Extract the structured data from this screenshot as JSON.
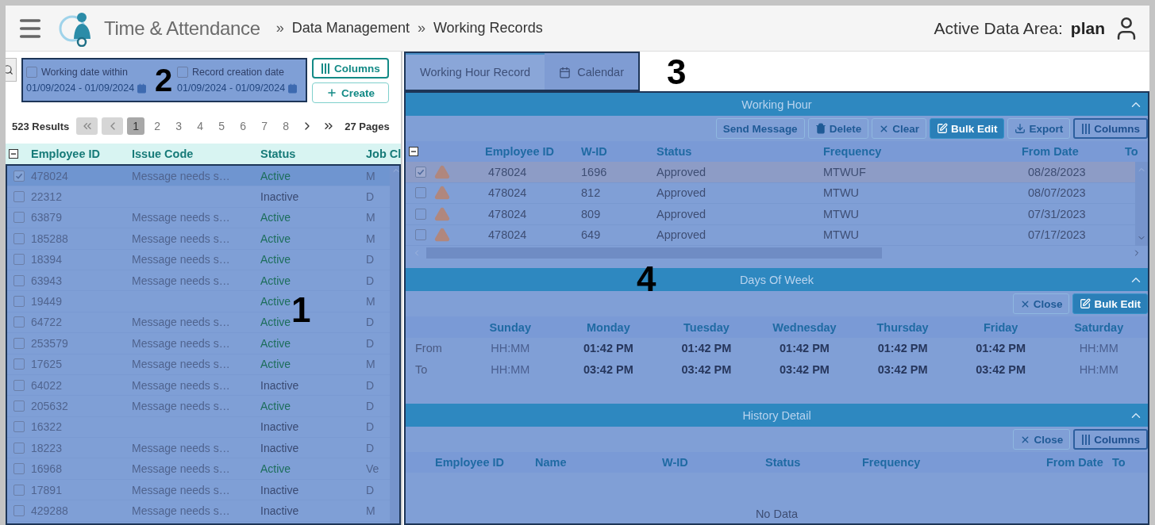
{
  "header": {
    "app_title": "Time & Attendance",
    "breadcrumbs": [
      {
        "separator": "»",
        "label": "Data Management"
      },
      {
        "separator": "»",
        "label": "Working Records"
      }
    ],
    "data_area_label": "Active Data Area:",
    "data_area_value": "plan"
  },
  "filters": [
    {
      "label": "Working date within",
      "checked": false,
      "range": "01/09/2024 - 01/09/2024"
    },
    {
      "label": "Record creation date",
      "checked": false,
      "range": "01/09/2024 - 01/09/2024"
    }
  ],
  "left_buttons": [
    {
      "label": "Columns",
      "kind": "columns"
    },
    {
      "label": "Create",
      "kind": "create"
    }
  ],
  "pagination": {
    "results": "523 Results",
    "pages": [
      {
        "label": "1",
        "selected": true
      },
      {
        "label": "2",
        "selected": false
      },
      {
        "label": "3",
        "selected": false
      },
      {
        "label": "4",
        "selected": false
      },
      {
        "label": "5",
        "selected": false
      },
      {
        "label": "6",
        "selected": false
      },
      {
        "label": "7",
        "selected": false
      },
      {
        "label": "8",
        "selected": false
      }
    ],
    "total": "27 Pages"
  },
  "employee_table": {
    "select_all_partial": true,
    "columns": [
      "Employee ID",
      "Issue Code",
      "Status",
      "Job Cl"
    ],
    "rows": [
      {
        "selected": true,
        "checked": true,
        "employee_id": "478024",
        "issue_code": "Message needs s…",
        "status": "Active",
        "kind": "active",
        "job": "M"
      },
      {
        "selected": false,
        "checked": false,
        "employee_id": "22312",
        "status": "Inactive",
        "kind": "inactive",
        "job": "D"
      },
      {
        "selected": false,
        "checked": false,
        "employee_id": "63879",
        "issue_code": "Message needs s…",
        "status": "Active",
        "kind": "active",
        "job": "M"
      },
      {
        "selected": false,
        "checked": false,
        "employee_id": "185288",
        "issue_code": "Message needs s…",
        "status": "Active",
        "kind": "active",
        "job": "M"
      },
      {
        "selected": false,
        "checked": false,
        "employee_id": "18394",
        "issue_code": "Message needs s…",
        "status": "Active",
        "kind": "active",
        "job": "D"
      },
      {
        "selected": false,
        "checked": false,
        "employee_id": "63943",
        "issue_code": "Message needs s…",
        "status": "Active",
        "kind": "active",
        "job": "D"
      },
      {
        "selected": false,
        "checked": false,
        "employee_id": "19449",
        "status": "Active",
        "kind": "active",
        "job": "M"
      },
      {
        "selected": false,
        "checked": false,
        "employee_id": "64722",
        "issue_code": "Message needs s…",
        "status": "Active",
        "kind": "active",
        "job": "D"
      },
      {
        "selected": false,
        "checked": false,
        "employee_id": "253579",
        "issue_code": "Message needs s…",
        "status": "Active",
        "kind": "active",
        "job": "D"
      },
      {
        "selected": false,
        "checked": false,
        "employee_id": "17625",
        "issue_code": "Message needs s…",
        "status": "Active",
        "kind": "active",
        "job": "M"
      },
      {
        "selected": false,
        "checked": false,
        "employee_id": "64022",
        "issue_code": "Message needs s…",
        "status": "Inactive",
        "kind": "inactive",
        "job": "D"
      },
      {
        "selected": false,
        "checked": false,
        "employee_id": "205632",
        "issue_code": "Message needs s…",
        "status": "Active",
        "kind": "active",
        "job": "D"
      },
      {
        "selected": false,
        "checked": false,
        "employee_id": "16322",
        "status": "Inactive",
        "kind": "inactive",
        "job": "D"
      },
      {
        "selected": false,
        "checked": false,
        "employee_id": "18223",
        "issue_code": "Message needs s…",
        "status": "Inactive",
        "kind": "inactive",
        "job": "D"
      },
      {
        "selected": false,
        "checked": false,
        "employee_id": "16968",
        "issue_code": "Message needs s…",
        "status": "Active",
        "kind": "active",
        "job": "Ve"
      },
      {
        "selected": false,
        "checked": false,
        "employee_id": "17891",
        "issue_code": "Message needs s…",
        "status": "Inactive",
        "kind": "inactive",
        "job": "D"
      },
      {
        "selected": false,
        "checked": false,
        "employee_id": "429288",
        "issue_code": "Message needs s…",
        "status": "Inactive",
        "kind": "inactive",
        "job": "M"
      }
    ]
  },
  "tabs": [
    {
      "label": "Working Hour Record",
      "selected": true,
      "kind": "plain"
    },
    {
      "label": "Calendar",
      "selected": false,
      "kind": "calendar"
    }
  ],
  "working_hour": {
    "title": "Working Hour",
    "select_all_partial": true,
    "buttons": [
      {
        "label": "Send Message",
        "kind": "plain"
      },
      {
        "label": "Delete",
        "kind": "delete"
      },
      {
        "label": "Clear",
        "kind": "clear"
      },
      {
        "label": "Bulk Edit",
        "kind": "edit"
      },
      {
        "label": "Export",
        "kind": "export"
      },
      {
        "label": "Columns",
        "kind": "columns"
      }
    ],
    "columns": [
      "Employee ID",
      "W-ID",
      "Status",
      "Frequency",
      "From Date",
      "To"
    ],
    "rows": [
      {
        "selected": true,
        "checked": true,
        "employee_id": "478024",
        "wid": "1696",
        "status": "Approved",
        "frequency": "MTWUF",
        "from_date": "08/28/2023"
      },
      {
        "selected": false,
        "checked": false,
        "employee_id": "478024",
        "wid": "812",
        "status": "Approved",
        "frequency": "MTWU",
        "from_date": "08/07/2023"
      },
      {
        "selected": false,
        "checked": false,
        "employee_id": "478024",
        "wid": "809",
        "status": "Approved",
        "frequency": "MTWU",
        "from_date": "07/31/2023"
      },
      {
        "selected": false,
        "checked": false,
        "employee_id": "478024",
        "wid": "649",
        "status": "Approved",
        "frequency": "MTWU",
        "from_date": "07/17/2023"
      }
    ]
  },
  "days_of_week": {
    "title": "Days Of Week",
    "buttons": [
      {
        "label": "Close",
        "kind": "clear"
      },
      {
        "label": "Bulk Edit",
        "kind": "edit"
      }
    ],
    "days": [
      "Sunday",
      "Monday",
      "Tuesday",
      "Wednesday",
      "Thursday",
      "Friday",
      "Saturday"
    ],
    "rows": [
      {
        "label": "From",
        "cells": [
          {
            "placeholder": "HH:MM"
          },
          {
            "value": "01:42 PM"
          },
          {
            "value": "01:42 PM"
          },
          {
            "value": "01:42 PM"
          },
          {
            "value": "01:42 PM"
          },
          {
            "value": "01:42 PM"
          },
          {
            "placeholder": "HH:MM"
          }
        ]
      },
      {
        "label": "To",
        "cells": [
          {
            "placeholder": "HH:MM"
          },
          {
            "value": "03:42 PM"
          },
          {
            "value": "03:42 PM"
          },
          {
            "value": "03:42 PM"
          },
          {
            "value": "03:42 PM"
          },
          {
            "value": "03:42 PM"
          },
          {
            "placeholder": "HH:MM"
          }
        ]
      }
    ]
  },
  "history_detail": {
    "title": "History Detail",
    "buttons": [
      {
        "label": "Close",
        "kind": "clear"
      },
      {
        "label": "Columns",
        "kind": "columns"
      }
    ],
    "columns": [
      "Employee ID",
      "Name",
      "W-ID",
      "Status",
      "Frequency",
      "From Date",
      "To"
    ],
    "empty": "No Data"
  },
  "callouts": [
    "1",
    "2",
    "3",
    "4"
  ]
}
